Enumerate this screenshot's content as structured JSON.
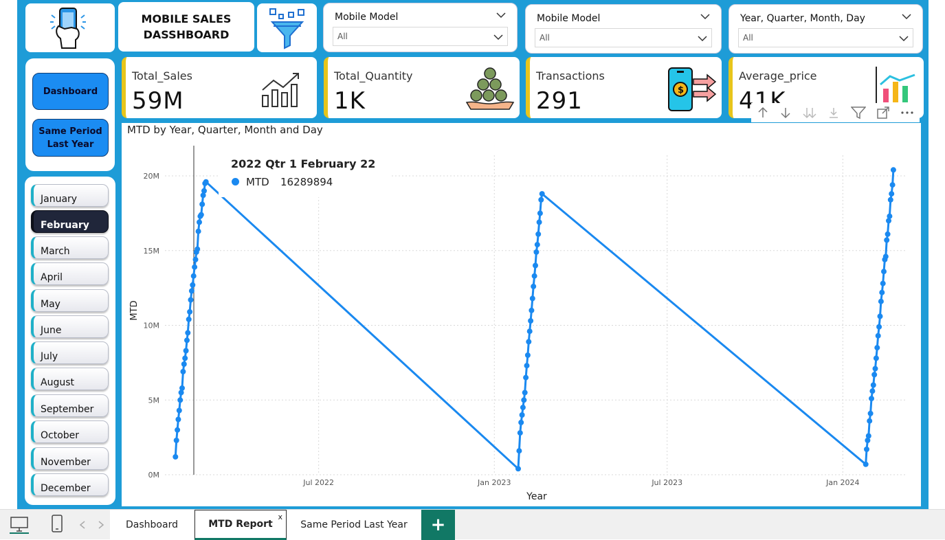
{
  "header": {
    "title_line1": "MOBILE SALES",
    "title_line2": "DASSHBOARD"
  },
  "slicers": [
    {
      "title": "Mobile Model",
      "value": "All"
    },
    {
      "title": "Mobile Model",
      "value": "All"
    },
    {
      "title": "Year, Quarter, Month, Day",
      "value": "All"
    }
  ],
  "nav": {
    "dashboard": "Dashboard",
    "same_period_line1": "Same Period",
    "same_period_line2": "Last Year"
  },
  "months": [
    "January",
    "February",
    "March",
    "April",
    "May",
    "June",
    "July",
    "August",
    "September",
    "October",
    "November",
    "December"
  ],
  "active_month": "February",
  "kpis": [
    {
      "label": "Total_Sales",
      "value": "59M"
    },
    {
      "label": "Total_Quantity",
      "value": "1K"
    },
    {
      "label": "Transactions",
      "value": "291"
    },
    {
      "label": "Average_price",
      "value": "41K"
    }
  ],
  "tooltip": {
    "title": "2022 Qtr 1 February 22",
    "series": "MTD",
    "value": "16289894"
  },
  "toolbar_icons": [
    "arrow-up-icon",
    "arrow-down-icon",
    "double-arrow-down-icon",
    "expand-down-icon",
    "filter-icon",
    "focus-mode-icon",
    "more-options-icon"
  ],
  "tabs": [
    "Dashboard",
    "MTD Report",
    "Same Period Last Year"
  ],
  "active_tab": "MTD Report",
  "tab_close": "x",
  "add_tab": "+",
  "colors": {
    "canvas": "#1e9cd7",
    "line": "#1a89f0",
    "kpi_accent": "#e8c51b",
    "nav_button": "#1b8cf2",
    "tab_accent": "#117865"
  },
  "chart_data": {
    "type": "line",
    "title": "MTD by Year, Quarter, Month and Day",
    "xlabel": "Year",
    "ylabel": "MTD",
    "x_ticks": [
      "Jul 2022",
      "Jan 2023",
      "Jul 2023",
      "Jan 2024"
    ],
    "y_ticks": [
      "0M",
      "5M",
      "10M",
      "15M",
      "20M"
    ],
    "ylim": [
      0,
      20000000
    ],
    "grid": true,
    "series": [
      {
        "name": "MTD",
        "points": [
          [
            "2022-02-01",
            1200000
          ],
          [
            "2022-02-02",
            2300000
          ],
          [
            "2022-02-03",
            3000000
          ],
          [
            "2022-02-04",
            3700000
          ],
          [
            "2022-02-05",
            4300000
          ],
          [
            "2022-02-06",
            5000000
          ],
          [
            "2022-02-07",
            5500000
          ],
          [
            "2022-02-08",
            5800000
          ],
          [
            "2022-02-09",
            6900000
          ],
          [
            "2022-02-10",
            7400000
          ],
          [
            "2022-02-11",
            7800000
          ],
          [
            "2022-02-12",
            8300000
          ],
          [
            "2022-02-13",
            9000000
          ],
          [
            "2022-02-14",
            9500000
          ],
          [
            "2022-02-15",
            10400000
          ],
          [
            "2022-02-16",
            10900000
          ],
          [
            "2022-02-17",
            11700000
          ],
          [
            "2022-02-18",
            12300000
          ],
          [
            "2022-02-19",
            12700000
          ],
          [
            "2022-02-20",
            13300000
          ],
          [
            "2022-02-21",
            13900000
          ],
          [
            "2022-02-22",
            14400000
          ],
          [
            "2022-02-23",
            14900000
          ],
          [
            "2022-02-24",
            15100000
          ],
          [
            "2022-02-25",
            16289894
          ],
          [
            "2022-02-26",
            16900000
          ],
          [
            "2022-02-27",
            17300000
          ],
          [
            "2022-02-28",
            17400000
          ],
          [
            "2022-03-01",
            18100000
          ],
          [
            "2022-03-02",
            18700000
          ],
          [
            "2022-03-03",
            19000000
          ],
          [
            "2022-03-04",
            19500000
          ],
          [
            "2022-03-05",
            19600000
          ],
          [
            "2023-01-26",
            400000
          ],
          [
            "2023-01-27",
            1600000
          ],
          [
            "2023-01-28",
            2800000
          ],
          [
            "2023-01-29",
            3500000
          ],
          [
            "2023-01-30",
            4000000
          ],
          [
            "2023-01-31",
            4500000
          ],
          [
            "2023-02-01",
            5000000
          ],
          [
            "2023-02-02",
            5500000
          ],
          [
            "2023-02-03",
            6500000
          ],
          [
            "2023-02-04",
            7300000
          ],
          [
            "2023-02-05",
            8000000
          ],
          [
            "2023-02-06",
            8900000
          ],
          [
            "2023-02-07",
            9600000
          ],
          [
            "2023-02-08",
            10300000
          ],
          [
            "2023-02-09",
            11000000
          ],
          [
            "2023-02-10",
            11800000
          ],
          [
            "2023-02-11",
            12600000
          ],
          [
            "2023-02-12",
            13300000
          ],
          [
            "2023-02-13",
            14000000
          ],
          [
            "2023-02-14",
            14900000
          ],
          [
            "2023-02-15",
            15400000
          ],
          [
            "2023-02-16",
            16100000
          ],
          [
            "2023-02-17",
            16900000
          ],
          [
            "2023-02-18",
            17500000
          ],
          [
            "2023-02-19",
            18400000
          ],
          [
            "2023-02-20",
            18800000
          ],
          [
            "2024-01-25",
            700000
          ],
          [
            "2024-01-26",
            1700000
          ],
          [
            "2024-01-27",
            2300000
          ],
          [
            "2024-01-28",
            2600000
          ],
          [
            "2024-01-29",
            3600000
          ],
          [
            "2024-01-30",
            4100000
          ],
          [
            "2024-01-31",
            5100000
          ],
          [
            "2024-02-01",
            5600000
          ],
          [
            "2024-02-02",
            6000000
          ],
          [
            "2024-02-03",
            6700000
          ],
          [
            "2024-02-04",
            7100000
          ],
          [
            "2024-02-05",
            7800000
          ],
          [
            "2024-02-06",
            8500000
          ],
          [
            "2024-02-07",
            9300000
          ],
          [
            "2024-02-08",
            9900000
          ],
          [
            "2024-02-09",
            10600000
          ],
          [
            "2024-02-10",
            11600000
          ],
          [
            "2024-02-11",
            12200000
          ],
          [
            "2024-02-12",
            12800000
          ],
          [
            "2024-02-13",
            13600000
          ],
          [
            "2024-02-14",
            14400000
          ],
          [
            "2024-02-15",
            14600000
          ],
          [
            "2024-02-16",
            15700000
          ],
          [
            "2024-02-17",
            16100000
          ],
          [
            "2024-02-18",
            17000000
          ],
          [
            "2024-02-19",
            17300000
          ],
          [
            "2024-02-20",
            18400000
          ],
          [
            "2024-02-21",
            18800000
          ],
          [
            "2024-02-22",
            19400000
          ],
          [
            "2024-02-23",
            20400000
          ]
        ]
      }
    ]
  }
}
